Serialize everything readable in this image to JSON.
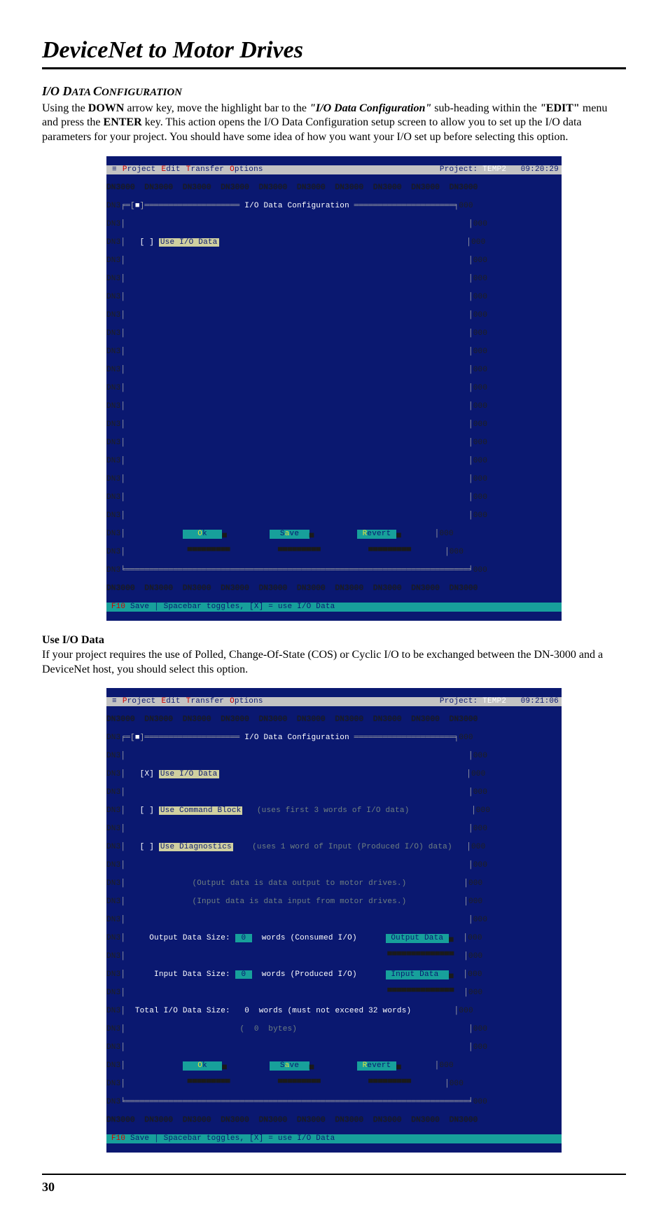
{
  "page_title": "DeviceNet to Motor Drives",
  "section_heading": {
    "pre": "I/O D",
    "mid1": "ATA ",
    "pre2": "C",
    "mid2": "ONFIGURATION"
  },
  "paragraph1": {
    "t1": "Using the ",
    "b1": "DOWN",
    "t2": " arrow key, move the highlight bar to the ",
    "bi1": "\"I/O Data Configuration\"",
    "t3": " sub-heading within the ",
    "bi2": "\"",
    "b2": "EDIT\"",
    "t4": " menu and press the ",
    "b3": "ENTER",
    "t5": " key.  This action opens the I/O Data Configuration setup screen to allow you to set up the I/O data parameters for your project.  You should have some idea of how you want your I/O set up before selecting this option."
  },
  "sub_heading1": "Use I/O Data",
  "paragraph2": "If your project requires the use of Polled, Change-Of-State (COS) or Cyclic I/O to be exchanged between the DN-3000 and a DeviceNet host, you should select this option.",
  "page_number": "30",
  "term_common": {
    "menu": {
      "project": "Project",
      "edit": "Edit",
      "transfer": "Transfer",
      "options": "Options",
      "proj_label": "Project:",
      "proj_name": "TEMP2"
    },
    "dn_fill": "DN3000  DN3000  DN3000  DN3000  DN3000  DN3000  DN3000  DN3000  DN3000  DN3000",
    "box_title": "I/O Data Configuration",
    "btn_ok": "Ok",
    "btn_save": "Save",
    "btn_revert": "Revert",
    "status_save": "F10",
    "status_save2": " Save",
    "status_hint": "Spacebar toggles, [X] = use I/O Data"
  },
  "term1": {
    "time": "09:20:29",
    "use_io": "Use I/O Data",
    "use_io_check": " "
  },
  "term2": {
    "time": "09:21:06",
    "use_io": "Use I/O Data",
    "use_io_check": "X",
    "use_cmd": "Use Command Block",
    "use_cmd_hint": "(uses first 3 words of I/O data)",
    "use_diag": "Use Diagnostics",
    "use_diag_hint": "(uses 1 word of Input (Produced I/O) data)",
    "hint1": "(Output data is data output to motor drives.)",
    "hint2": "(Input data is data input from motor drives.)",
    "out_label": "Output Data Size:",
    "out_val": "0",
    "out_unit": "words (Consumed I/O)",
    "out_btn": "Output Data",
    "in_label": "Input Data Size:",
    "in_val": "0",
    "in_unit": "words (Produced I/O)",
    "in_btn": "Input Data",
    "tot_label": "Total I/O Data Size:",
    "tot_val": "0",
    "tot_unit": "words (must not exceed 32 words)",
    "tot_bytes_l": "(",
    "tot_bytes_v": "0",
    "tot_bytes_r": "bytes)"
  }
}
